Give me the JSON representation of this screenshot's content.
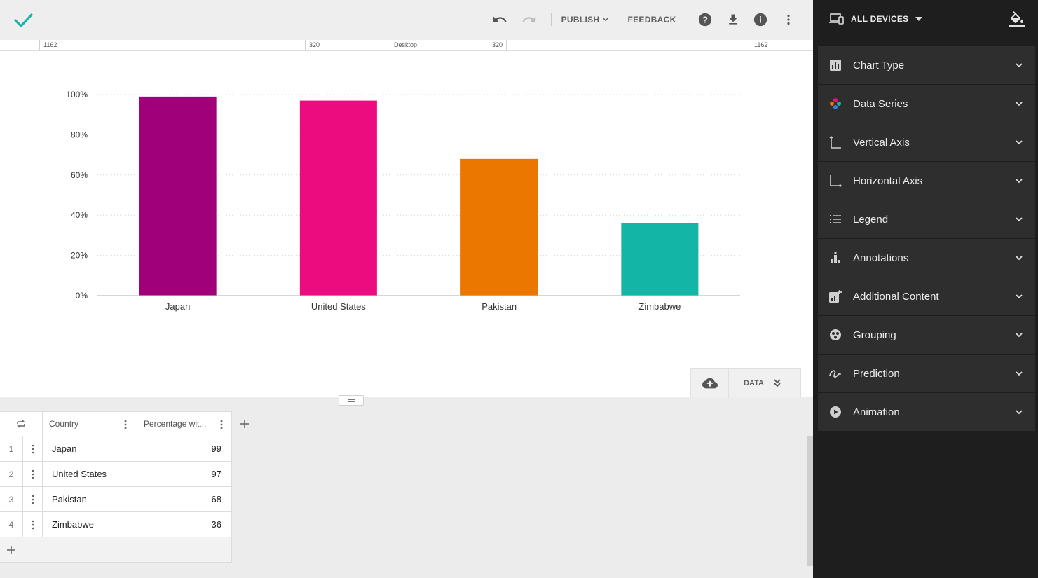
{
  "toolbar": {
    "publish_label": "PUBLISH",
    "feedback_label": "FEEDBACK"
  },
  "ruler": {
    "left_outer": "1162",
    "left_inner": "320",
    "device": "Desktop",
    "right_inner": "320",
    "right_outer": "1162"
  },
  "colors": {
    "accent": "#1ab3a6",
    "japan": "#a1007b",
    "united_states": "#ec0c7f",
    "pakistan": "#eb7700",
    "zimbabwe": "#12b5a6"
  },
  "chart_data": {
    "type": "bar",
    "categories": [
      "Japan",
      "United States",
      "Pakistan",
      "Zimbabwe"
    ],
    "values": [
      99,
      97,
      68,
      36
    ],
    "colors": [
      "#a1007b",
      "#ec0c7f",
      "#eb7700",
      "#12b5a6"
    ],
    "ylim": [
      0,
      100
    ],
    "yticks": [
      "0%",
      "20%",
      "40%",
      "60%",
      "80%",
      "100%"
    ],
    "grid": true,
    "legend": "none"
  },
  "data_panel": {
    "label": "DATA"
  },
  "table": {
    "headers": [
      "Country",
      "Percentage wit..."
    ],
    "rows": [
      {
        "num": "1",
        "country": "Japan",
        "value": "99"
      },
      {
        "num": "2",
        "country": "United States",
        "value": "97"
      },
      {
        "num": "3",
        "country": "Pakistan",
        "value": "68"
      },
      {
        "num": "4",
        "country": "Zimbabwe",
        "value": "36"
      }
    ]
  },
  "sidebar": {
    "devices_label": "ALL DEVICES",
    "panels": [
      {
        "label": "Chart Type",
        "icon": "bar-chart-icon"
      },
      {
        "label": "Data Series",
        "icon": "data-series-icon"
      },
      {
        "label": "Vertical Axis",
        "icon": "vertical-axis-icon"
      },
      {
        "label": "Horizontal Axis",
        "icon": "horizontal-axis-icon"
      },
      {
        "label": "Legend",
        "icon": "legend-icon"
      },
      {
        "label": "Annotations",
        "icon": "annotations-icon"
      },
      {
        "label": "Additional Content",
        "icon": "additional-content-icon"
      },
      {
        "label": "Grouping",
        "icon": "grouping-icon"
      },
      {
        "label": "Prediction",
        "icon": "prediction-icon"
      },
      {
        "label": "Animation",
        "icon": "animation-icon"
      }
    ]
  }
}
